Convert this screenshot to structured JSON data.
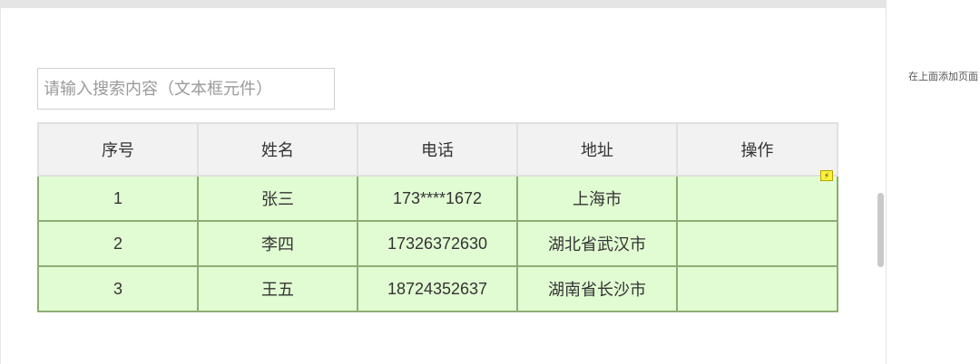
{
  "search": {
    "placeholder": "请输入搜索内容（文本框元件）"
  },
  "table": {
    "headers": [
      "序号",
      "姓名",
      "电话",
      "地址",
      "操作"
    ],
    "rows": [
      {
        "index": "1",
        "name": "张三",
        "phone": "173****1672",
        "address": "上海市",
        "action": ""
      },
      {
        "index": "2",
        "name": "李四",
        "phone": "17326372630",
        "address": "湖北省武汉市",
        "action": ""
      },
      {
        "index": "3",
        "name": "王五",
        "phone": "18724352637",
        "address": "湖南省长沙市",
        "action": ""
      }
    ]
  },
  "side_panel": {
    "hint": "在上面添加页面"
  },
  "icons": {
    "interaction_badge": "lightning-icon"
  },
  "colors": {
    "row_background": "#e1fcd2",
    "row_border": "#8bad74",
    "header_background": "#f2f2f2",
    "badge": "#fff03a"
  }
}
